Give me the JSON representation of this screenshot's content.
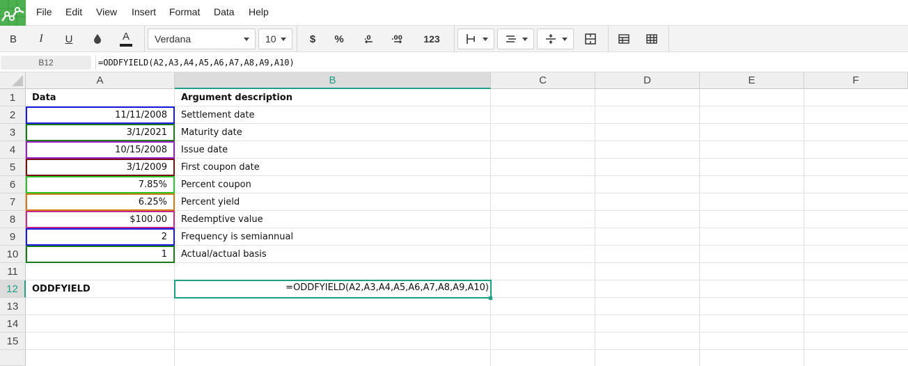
{
  "menu": [
    "File",
    "Edit",
    "View",
    "Insert",
    "Format",
    "Data",
    "Help"
  ],
  "toolbar": {
    "bold": "B",
    "italic": "I",
    "underline": "U",
    "text_color": "A",
    "font_name": "Verdana",
    "font_size": "10",
    "currency": "$",
    "percent": "%",
    "number_format": "123"
  },
  "formula_bar": {
    "name_box": "B12",
    "formula": "=ODDFYIELD(A2,A3,A4,A5,A6,A7,A8,A9,A10)"
  },
  "columns": [
    "A",
    "B",
    "C",
    "D",
    "E",
    "F"
  ],
  "selected_column": "B",
  "rows": [
    "1",
    "2",
    "3",
    "4",
    "5",
    "6",
    "7",
    "8",
    "9",
    "10",
    "11",
    "12",
    "13",
    "14",
    "15"
  ],
  "selected_row": "12",
  "cells": {
    "A1": "Data",
    "B1": "Argument description",
    "A2": "11/11/2008",
    "B2": "Settlement date",
    "A3": "3/1/2021",
    "B3": "Maturity date",
    "A4": "10/15/2008",
    "B4": "Issue date",
    "A5": "3/1/2009",
    "B5": "First coupon date",
    "A6": "7.85%",
    "B6": "Percent coupon",
    "A7": "6.25%",
    "B7": "Percent yield",
    "A8": "$100.00",
    "B8": "Redemptive value",
    "A9": "2",
    "B9": "Frequency is semiannual",
    "A10": "1",
    "B10": "Actual/actual basis",
    "A12": "ODDFYIELD",
    "B12": "=ODDFYIELD(A2,A3,A4,A5,A6,A7,A8,A9,A10)"
  },
  "colors": {
    "accent": "#1e9f85",
    "logo": "#4caf50",
    "ref_A2": "#1a1adb",
    "ref_A3": "#1a7a1a",
    "ref_A4": "#9b1fc7",
    "ref_A5": "#7a1010",
    "ref_A6": "#2ec42e",
    "ref_A7": "#d07a1a",
    "ref_A8": "#c62a8a",
    "ref_A9": "#1a1adb",
    "ref_A10": "#1a7a1a"
  }
}
